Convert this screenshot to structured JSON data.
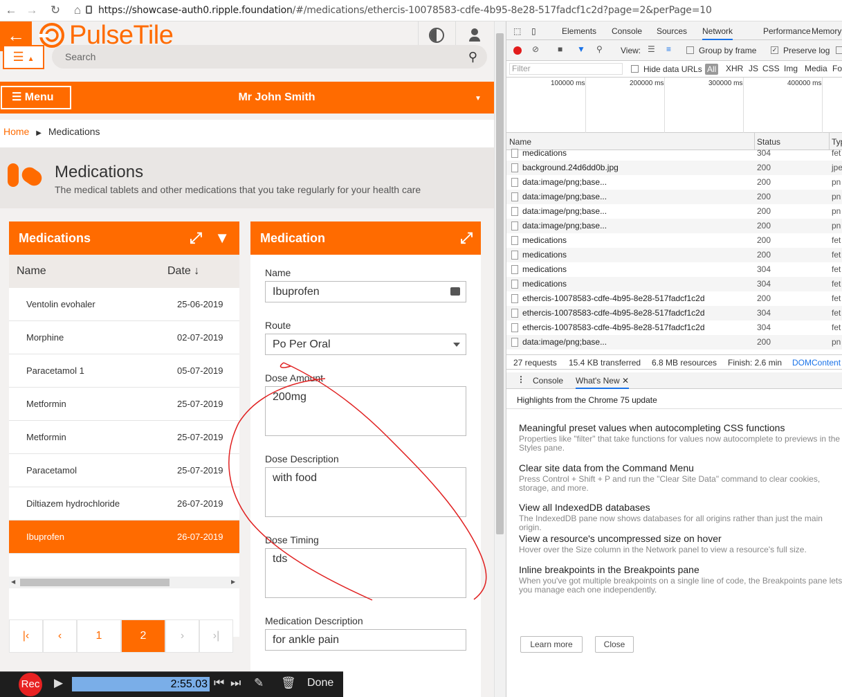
{
  "browser": {
    "url_host": "https://showcase-auth0.ripple.foundation",
    "url_path": "/#/medications/ethercis-10078583-cdfe-4b95-8e28-517fadcf1c2d?page=2&perPage=10"
  },
  "app": {
    "logo_text": "PulseTile",
    "search_placeholder": "Search",
    "menu_label": "Menu",
    "patient_name": "Mr John Smith",
    "breadcrumb": {
      "home": "Home",
      "current": "Medications"
    },
    "page_title": "Medications",
    "page_subtitle": "The medical tablets and other medications that you take regularly for your health care",
    "brand_color": "#ff6b00"
  },
  "list": {
    "title": "Medications",
    "col_name": "Name",
    "col_date": "Date",
    "rows": [
      {
        "name": "Ventolin evohaler",
        "date": "25-06-2019"
      },
      {
        "name": "Morphine",
        "date": "02-07-2019"
      },
      {
        "name": "Paracetamol 1",
        "date": "05-07-2019"
      },
      {
        "name": "Metformin",
        "date": "25-07-2019"
      },
      {
        "name": "Metformin",
        "date": "25-07-2019"
      },
      {
        "name": "Paracetamol",
        "date": "25-07-2019"
      },
      {
        "name": "Diltiazem hydrochloride",
        "date": "26-07-2019"
      },
      {
        "name": "Ibuprofen",
        "date": "26-07-2019"
      }
    ],
    "selected_index": 7,
    "pager": {
      "page1": "1",
      "page2": "2"
    }
  },
  "detail": {
    "title": "Medication",
    "name_label": "Name",
    "name_value": "Ibuprofen",
    "route_label": "Route",
    "route_value": "Po Per Oral",
    "dose_amount_label": "Dose Amount",
    "dose_amount_value": "200mg",
    "dose_desc_label": "Dose Description",
    "dose_desc_value": "with food",
    "dose_timing_label": "Dose Timing",
    "dose_timing_value": "tds",
    "med_desc_label": "Medication Description",
    "med_desc_value": "for ankle pain"
  },
  "recorder": {
    "rec_label": "Rec",
    "time": "2:55.03",
    "done_label": "Done"
  },
  "devtools": {
    "tabs": [
      "Elements",
      "Console",
      "Sources",
      "Network",
      "Performance",
      "Memory"
    ],
    "active_tab": "Network",
    "view_label": "View:",
    "group_by_frame": "Group by frame",
    "preserve_log": "Preserve log",
    "filter_placeholder": "Filter",
    "hide_data_urls": "Hide data URLs",
    "type_filters": [
      "All",
      "XHR",
      "JS",
      "CSS",
      "Img",
      "Media",
      "Fo"
    ],
    "ticks": [
      "100000 ms",
      "200000 ms",
      "300000 ms",
      "400000 ms"
    ],
    "col_name": "Name",
    "col_status": "Status",
    "col_type": "Typ",
    "requests": [
      {
        "name": "medications",
        "status": "304",
        "type": "fet"
      },
      {
        "name": "background.24d6dd0b.jpg",
        "status": "200",
        "type": "jpe"
      },
      {
        "name": "data:image/png;base...",
        "status": "200",
        "type": "pn"
      },
      {
        "name": "data:image/png;base...",
        "status": "200",
        "type": "pn"
      },
      {
        "name": "data:image/png;base...",
        "status": "200",
        "type": "pn"
      },
      {
        "name": "data:image/png;base...",
        "status": "200",
        "type": "pn"
      },
      {
        "name": "medications",
        "status": "200",
        "type": "fet"
      },
      {
        "name": "medications",
        "status": "200",
        "type": "fet"
      },
      {
        "name": "medications",
        "status": "304",
        "type": "fet"
      },
      {
        "name": "medications",
        "status": "304",
        "type": "fet"
      },
      {
        "name": "ethercis-10078583-cdfe-4b95-8e28-517fadcf1c2d",
        "status": "200",
        "type": "fet"
      },
      {
        "name": "ethercis-10078583-cdfe-4b95-8e28-517fadcf1c2d",
        "status": "304",
        "type": "fet"
      },
      {
        "name": "ethercis-10078583-cdfe-4b95-8e28-517fadcf1c2d",
        "status": "304",
        "type": "fet"
      },
      {
        "name": "data:image/png;base...",
        "status": "200",
        "type": "pn"
      }
    ],
    "summary": {
      "requests": "27 requests",
      "transferred": "15.4 KB transferred",
      "resources": "6.8 MB resources",
      "finish": "Finish: 2.6 min",
      "domcontent": "DOMContent"
    },
    "drawer_tabs": {
      "console": "Console",
      "whats_new": "What's New"
    },
    "whats_new": {
      "intro": "Highlights from the Chrome 75 update",
      "items": [
        {
          "title": "Meaningful preset values when autocompleting CSS functions",
          "body": "Properties like \"filter\" that take functions for values now autocomplete to previews in the Styles pane."
        },
        {
          "title": "Clear site data from the Command Menu",
          "body": "Press Control + Shift + P and run the \"Clear Site Data\" command to clear cookies, storage, and more."
        },
        {
          "title": "View all IndexedDB databases",
          "body": "The IndexedDB pane now shows databases for all origins rather than just the main origin."
        },
        {
          "title": "View a resource's uncompressed size on hover",
          "body": "Hover over the Size column in the Network panel to view a resource's full size."
        },
        {
          "title": "Inline breakpoints in the Breakpoints pane",
          "body": "When you've got multiple breakpoints on a single line of code, the Breakpoints pane lets you manage each one independently."
        }
      ],
      "learn_more": "Learn more",
      "close": "Close"
    }
  }
}
